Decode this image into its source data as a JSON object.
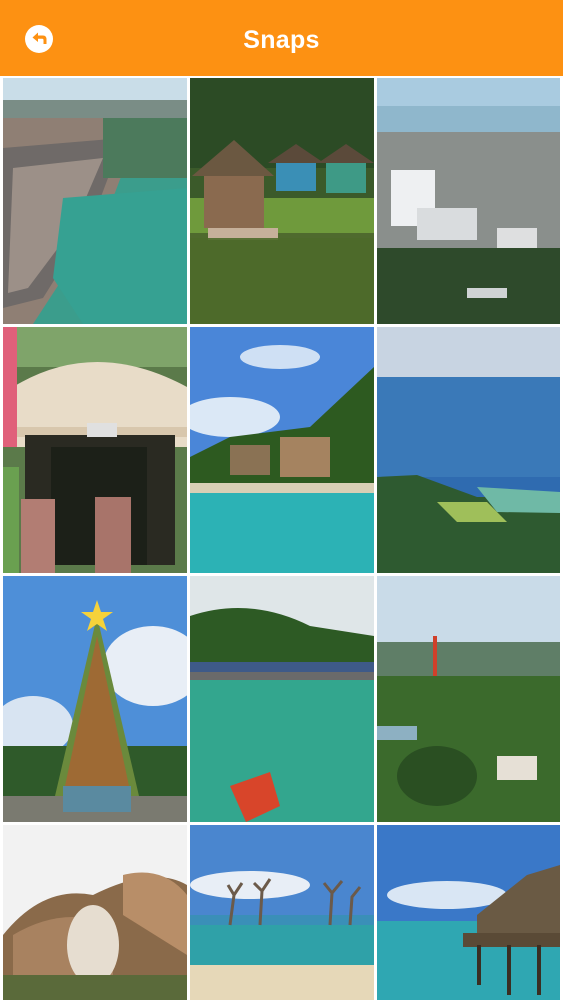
{
  "header": {
    "title": "Snaps",
    "back_icon": "back-arrow-icon",
    "bar_color": "#fd9112"
  },
  "gallery": {
    "photos": [
      {
        "name": "aerial-stilt-village"
      },
      {
        "name": "thatched-cottages-lagoon"
      },
      {
        "name": "city-skyline-aerial"
      },
      {
        "name": "resort-entrance-gate"
      },
      {
        "name": "beach-resort-palms"
      },
      {
        "name": "coastline-aerial-view"
      },
      {
        "name": "bottle-christmas-tree"
      },
      {
        "name": "lagoon-floating-boardwalk"
      },
      {
        "name": "hills-radio-tower"
      },
      {
        "name": "eagle-statue"
      },
      {
        "name": "dead-trees-in-sea"
      },
      {
        "name": "overwater-hut"
      }
    ]
  }
}
